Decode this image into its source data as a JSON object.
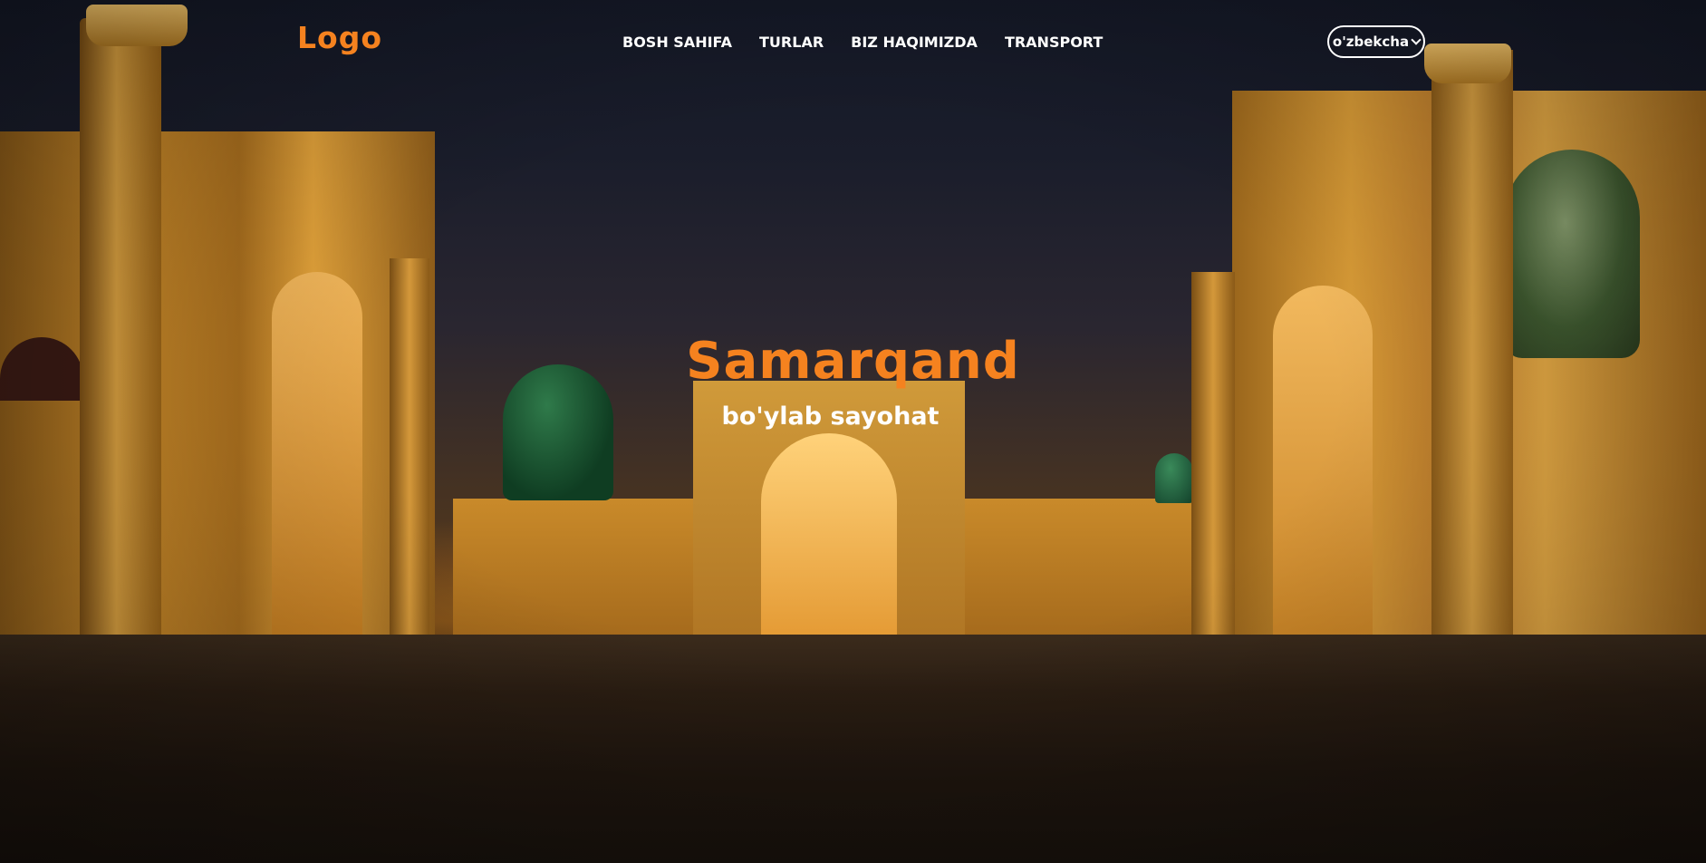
{
  "header": {
    "logo": "Logo",
    "nav": [
      {
        "label": "BOSH SAHIFA"
      },
      {
        "label": "TURLAR"
      },
      {
        "label": "BIZ HAQIMIZDA"
      },
      {
        "label": "TRANSPORT"
      }
    ],
    "language": {
      "selected": "o'zbekcha"
    }
  },
  "hero": {
    "title": "Samarqand",
    "subtitle": "bo'ylab sayohat",
    "background": "Registan square at night"
  },
  "colors": {
    "accent": "#f5821f",
    "nav_text": "#ffffff"
  },
  "icons": {
    "language_dropdown": "chevron-down-icon"
  }
}
